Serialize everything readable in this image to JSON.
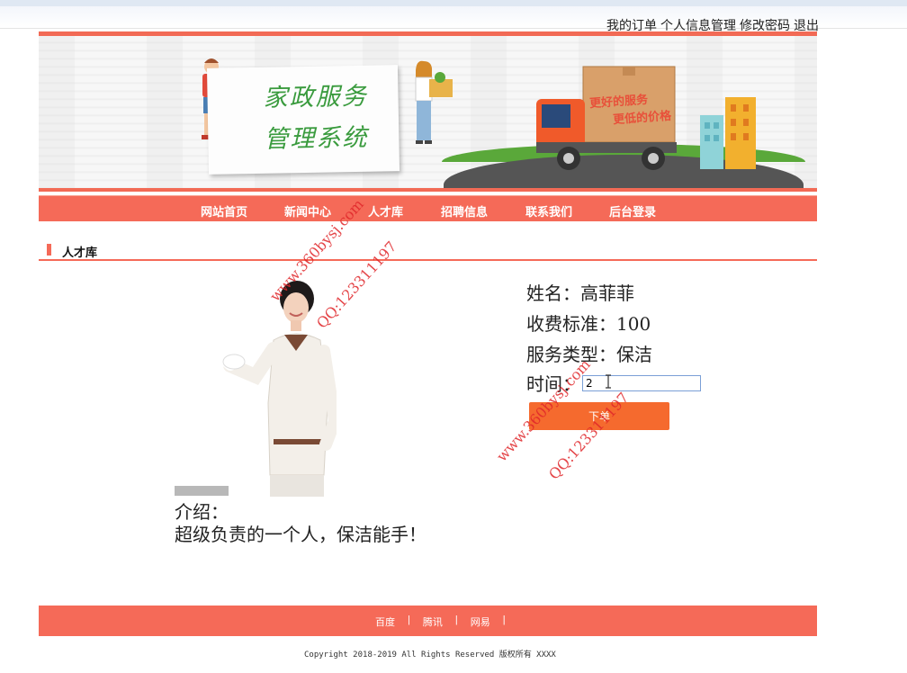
{
  "topbar": {
    "links": [
      "我的订单",
      "个人信息管理",
      "修改密码",
      "退出"
    ]
  },
  "banner": {
    "title_line1": "家政服务",
    "title_line2": "管理系统",
    "truck_line1": "更好的服务",
    "truck_line2": "更低的价格"
  },
  "nav": {
    "items": [
      "网站首页",
      "新闻中心",
      "人才库",
      "招聘信息",
      "联系我们",
      "后台登录"
    ]
  },
  "section": {
    "title": "人才库"
  },
  "profile": {
    "name_label": "姓名：高菲菲",
    "fee_label": "收费标准：100",
    "service_label": "服务类型：保洁",
    "time_label": "时间：",
    "time_value": "2",
    "order_button": "下单",
    "intro_label": "介绍：",
    "intro_text": "超级负责的一个人，保洁能手！"
  },
  "footer": {
    "links": [
      "百度",
      "腾讯",
      "网易"
    ],
    "separator": "|",
    "copyright": "Copyright 2018-2019 All Rights Reserved 版权所有 XXXX"
  },
  "watermark": {
    "site": "www.360bysj.com",
    "qq": "QQ:123311197"
  },
  "colors": {
    "accent": "#f56a58",
    "button": "#f56a2e"
  }
}
